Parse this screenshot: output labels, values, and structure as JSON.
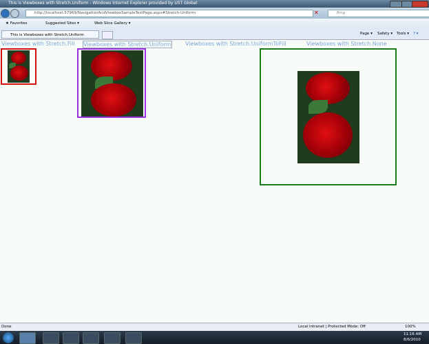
{
  "window": {
    "title": "This is Viewboxes with Stretch.Uniform - Windows Internet Explorer provided by UST Global"
  },
  "address": {
    "url": "http://localhost:57969/NavigationAndViewboxSampleTestPage.aspx#Stretch-Uniform",
    "search_placeholder": "Bing"
  },
  "favorites": {
    "favorites_label": "Favorites",
    "suggested": "Suggested Sites ▾",
    "webslice": "Web Slice Gallery ▾"
  },
  "tab": {
    "label": "This is Viewboxes with Stretch.Uniform"
  },
  "commandbar": {
    "page": "Page ▾",
    "safety": "Safety ▾",
    "tools": "Tools ▾",
    "help": "? ▾"
  },
  "links": [
    "Viewboxes with Stretch.Fill",
    "Viewboxes with Stretch.Uniform",
    "Viewboxes with Stretch.UniformToFill",
    "Viewboxes with Stretch.None"
  ],
  "status": {
    "text": "Done",
    "zone": "Local intranet | Protected Mode: Off",
    "zoom": "100%"
  },
  "taskbar": {
    "time": "11:16 AM",
    "date": "8/6/2010"
  },
  "colors": {
    "fill_border": "#d01010",
    "uniform_border": "#9b30e0",
    "none_border": "#1a7a1a"
  }
}
